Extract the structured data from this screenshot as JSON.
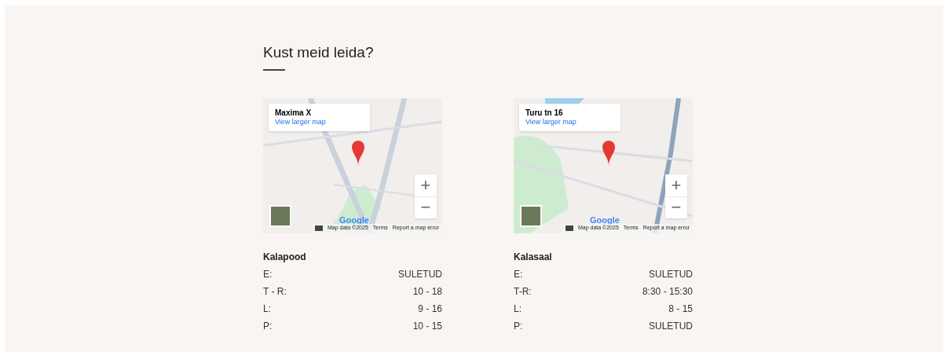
{
  "heading": "Kust meid leida?",
  "locations": [
    {
      "map": {
        "place": "Maxima X",
        "link": "View larger map",
        "zoom_in": "+",
        "zoom_out": "−",
        "logo": "Google",
        "attribution": "Map data ©2025",
        "terms": "Terms",
        "report": "Report a map error"
      },
      "name": "Kalapood",
      "hours": [
        {
          "day": "E:",
          "time": "SULETUD"
        },
        {
          "day": "T - R:",
          "time": "10 - 18"
        },
        {
          "day": "L:",
          "time": "9 - 16"
        },
        {
          "day": "P:",
          "time": "10 - 15"
        }
      ]
    },
    {
      "map": {
        "place": "Turu tn 16",
        "link": "View larger map",
        "zoom_in": "+",
        "zoom_out": "−",
        "logo": "Google",
        "attribution": "Map data ©2025",
        "terms": "Terms",
        "report": "Report a map error"
      },
      "name": "Kalasaal",
      "hours": [
        {
          "day": "E:",
          "time": "SULETUD"
        },
        {
          "day": "T-R:",
          "time": "8:30 - 15:30"
        },
        {
          "day": "L:",
          "time": "8 - 15"
        },
        {
          "day": "P:",
          "time": "SULETUD"
        }
      ]
    }
  ]
}
